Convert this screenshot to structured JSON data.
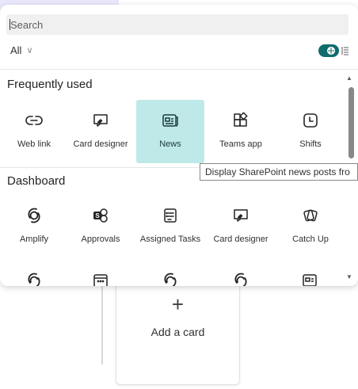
{
  "search": {
    "placeholder": "Search"
  },
  "filter": {
    "label": "All",
    "chevron_icon": "chevron-down-icon"
  },
  "view_toggle": {
    "state": "grid",
    "accent": "#106b6b"
  },
  "sections": [
    {
      "title": "Frequently used",
      "items": [
        {
          "label": "Web link",
          "icon": "link-icon"
        },
        {
          "label": "Card designer",
          "icon": "card-designer-icon"
        },
        {
          "label": "News",
          "icon": "news-icon",
          "selected": true
        },
        {
          "label": "Teams app",
          "icon": "teams-app-icon"
        },
        {
          "label": "Shifts",
          "icon": "clock-icon"
        }
      ]
    },
    {
      "title": "Dashboard",
      "items": [
        {
          "label": "Amplify",
          "icon": "amplify-icon"
        },
        {
          "label": "Approvals",
          "icon": "approvals-icon"
        },
        {
          "label": "Assigned Tasks",
          "icon": "assigned-tasks-icon"
        },
        {
          "label": "Card designer",
          "icon": "card-designer-icon"
        },
        {
          "label": "Catch Up",
          "icon": "catch-up-icon"
        }
      ]
    }
  ],
  "tooltip": {
    "text": "Display SharePoint news posts fro"
  },
  "background": {
    "add_card_plus": "+",
    "add_card_label": "Add a card"
  },
  "colors": {
    "selected": "#bfe9e9",
    "accent": "#106b6b",
    "tint": "#e9e7fb"
  }
}
